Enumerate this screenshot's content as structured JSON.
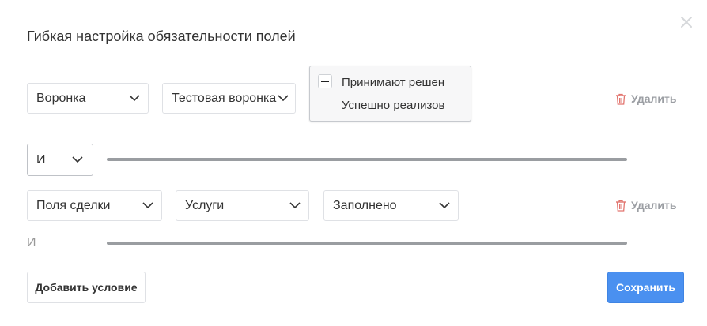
{
  "dialog": {
    "title": "Гибкая настройка обязательности полей",
    "close_icon": "close-icon"
  },
  "condition1": {
    "field_select": "Воронка",
    "funnel_select": "Тестовая воронка",
    "stages": [
      "Принимают решен",
      "Успешно реализов"
    ],
    "delete_label": "Удалить"
  },
  "connector1": {
    "value": "И"
  },
  "condition2": {
    "field_select": "Поля сделки",
    "value_select": "Услуги",
    "state_select": "Заполнено",
    "delete_label": "Удалить"
  },
  "connector2": {
    "value": "И"
  },
  "footer": {
    "add_condition_label": "Добавить условие",
    "save_label": "Сохранить"
  },
  "colors": {
    "primary": "#4a90f0",
    "delete_icon": "#e2756f",
    "divider": "#9a9da1"
  }
}
